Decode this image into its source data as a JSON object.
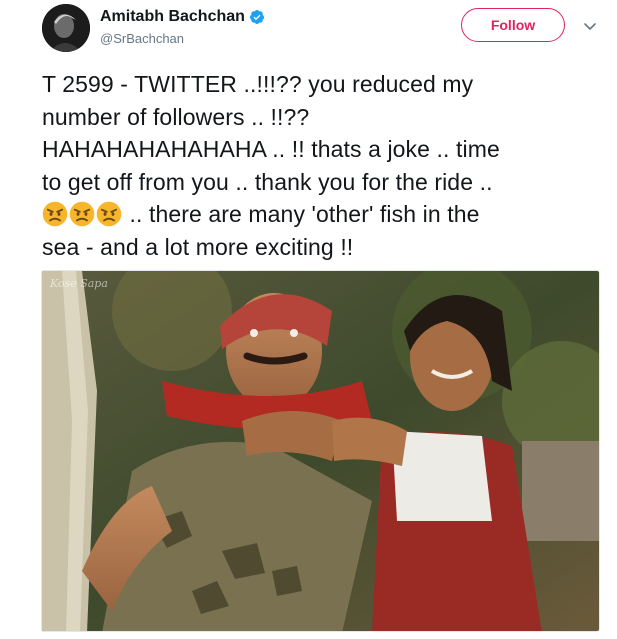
{
  "author": {
    "display_name": "Amitabh Bachchan",
    "handle": "@SrBachchan",
    "verified": true,
    "avatar_icon": "profile-photo"
  },
  "actions": {
    "follow_label": "Follow",
    "more_icon": "chevron-down-icon"
  },
  "tweet": {
    "line1": "T 2599 - TWITTER ..!!!??  you reduced my",
    "line2": "number of followers .. !!??",
    "line3": "HAHAHAHAHAHAHA .. !! thats a joke .. time",
    "line4": "to get off from you .. thank you for the ride ..",
    "line5": " .. there are many 'other' fish in the",
    "line6": "sea - and a lot more exciting !!",
    "emojis": [
      "angry-face",
      "angry-face",
      "angry-face"
    ]
  },
  "media": {
    "watermark": "Kose Sapa",
    "description_icon": "film-still-image"
  },
  "colors": {
    "follow_accent": "#e0245e",
    "verified_blue": "#1da1f2",
    "secondary_text": "#657786"
  }
}
